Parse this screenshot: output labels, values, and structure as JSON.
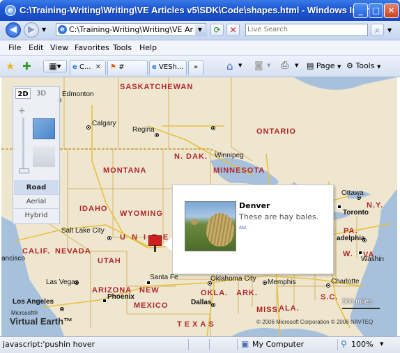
{
  "window": {
    "title": "C:\\Training-Writing\\Writing\\VE Articles v5\\SDK\\Code\\shapes.html - Windows Inter...",
    "minimize_glyph": "_",
    "maximize_glyph": "□",
    "close_glyph": "✕"
  },
  "address_bar": {
    "url": "C:\\Training-Writing\\Writing\\VE Articles v5"
  },
  "search": {
    "placeholder": "Live Search"
  },
  "menu": [
    "File",
    "Edit",
    "View",
    "Favorites",
    "Tools",
    "Help"
  ],
  "tabs": [
    {
      "label": "C..."
    },
    {
      "label": "#"
    },
    {
      "label": "VESh..."
    }
  ],
  "tab_overflow": "»",
  "commands": {
    "page": "Page",
    "tools": "Tools"
  },
  "map": {
    "view_buttons": {
      "two_d": "2D",
      "three_d": "3D"
    },
    "modes": [
      "Road",
      "Aerial",
      "Hybrid"
    ],
    "selected_mode": "Road",
    "states": [
      "SASKATCHEWAN",
      "ONTARIO",
      "N. DAK.",
      "MONTANA",
      "MINNESOTA",
      "IDAHO",
      "WYOMING",
      "CALIF.",
      "NEVADA",
      "UTAH",
      "ARIZONA",
      "NEW",
      "MEXICO",
      "OKLA.",
      "ARK.",
      "TEXAS",
      "MISS.",
      "ALA.",
      "N.Y.",
      "PA.",
      "S.C.",
      "VA.",
      "W.",
      "U N I T E D"
    ],
    "cities": [
      "Edmonton",
      "Calgary",
      "Regina",
      "Winnipeg",
      "Ottawa",
      "Toronto",
      "Salt Lake City",
      "Las Vegas",
      "Los Angeles",
      "Phoenix",
      "Santa Fe",
      "Oklahoma City",
      "Memphis",
      "Charlotte",
      "Dallas",
      "adelphia",
      "Washin",
      "ancisco"
    ],
    "scale": "500 miles",
    "branding": {
      "line1": "Microsoft®",
      "line2": "Virtual Earth™"
    },
    "copyright": "© 2006 Microsoft Corporation   © 2006 NAVTEQ",
    "pushpin": {
      "title": "Denver",
      "description": "These are hay bales.",
      "link": "..."
    }
  },
  "status": {
    "text": "javascript:'pushin hover",
    "zone": "My Computer",
    "zoom": "100%"
  }
}
